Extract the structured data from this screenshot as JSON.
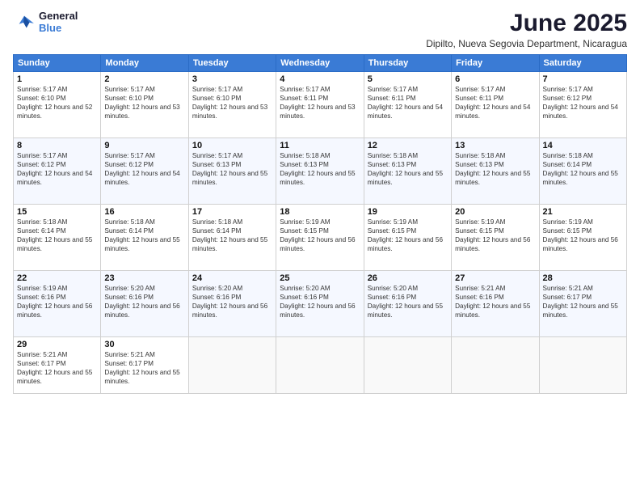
{
  "header": {
    "logo_line1": "General",
    "logo_line2": "Blue",
    "month": "June 2025",
    "location": "Dipilto, Nueva Segovia Department, Nicaragua"
  },
  "days_of_week": [
    "Sunday",
    "Monday",
    "Tuesday",
    "Wednesday",
    "Thursday",
    "Friday",
    "Saturday"
  ],
  "weeks": [
    [
      {
        "day": 1,
        "rise": "5:17 AM",
        "set": "6:10 PM",
        "hours": "12 hours and 52 minutes"
      },
      {
        "day": 2,
        "rise": "5:17 AM",
        "set": "6:10 PM",
        "hours": "12 hours and 53 minutes"
      },
      {
        "day": 3,
        "rise": "5:17 AM",
        "set": "6:10 PM",
        "hours": "12 hours and 53 minutes"
      },
      {
        "day": 4,
        "rise": "5:17 AM",
        "set": "6:11 PM",
        "hours": "12 hours and 53 minutes"
      },
      {
        "day": 5,
        "rise": "5:17 AM",
        "set": "6:11 PM",
        "hours": "12 hours and 54 minutes"
      },
      {
        "day": 6,
        "rise": "5:17 AM",
        "set": "6:11 PM",
        "hours": "12 hours and 54 minutes"
      },
      {
        "day": 7,
        "rise": "5:17 AM",
        "set": "6:12 PM",
        "hours": "12 hours and 54 minutes"
      }
    ],
    [
      {
        "day": 8,
        "rise": "5:17 AM",
        "set": "6:12 PM",
        "hours": "12 hours and 54 minutes"
      },
      {
        "day": 9,
        "rise": "5:17 AM",
        "set": "6:12 PM",
        "hours": "12 hours and 54 minutes"
      },
      {
        "day": 10,
        "rise": "5:17 AM",
        "set": "6:13 PM",
        "hours": "12 hours and 55 minutes"
      },
      {
        "day": 11,
        "rise": "5:18 AM",
        "set": "6:13 PM",
        "hours": "12 hours and 55 minutes"
      },
      {
        "day": 12,
        "rise": "5:18 AM",
        "set": "6:13 PM",
        "hours": "12 hours and 55 minutes"
      },
      {
        "day": 13,
        "rise": "5:18 AM",
        "set": "6:13 PM",
        "hours": "12 hours and 55 minutes"
      },
      {
        "day": 14,
        "rise": "5:18 AM",
        "set": "6:14 PM",
        "hours": "12 hours and 55 minutes"
      }
    ],
    [
      {
        "day": 15,
        "rise": "5:18 AM",
        "set": "6:14 PM",
        "hours": "12 hours and 55 minutes"
      },
      {
        "day": 16,
        "rise": "5:18 AM",
        "set": "6:14 PM",
        "hours": "12 hours and 55 minutes"
      },
      {
        "day": 17,
        "rise": "5:18 AM",
        "set": "6:14 PM",
        "hours": "12 hours and 55 minutes"
      },
      {
        "day": 18,
        "rise": "5:19 AM",
        "set": "6:15 PM",
        "hours": "12 hours and 56 minutes"
      },
      {
        "day": 19,
        "rise": "5:19 AM",
        "set": "6:15 PM",
        "hours": "12 hours and 56 minutes"
      },
      {
        "day": 20,
        "rise": "5:19 AM",
        "set": "6:15 PM",
        "hours": "12 hours and 56 minutes"
      },
      {
        "day": 21,
        "rise": "5:19 AM",
        "set": "6:15 PM",
        "hours": "12 hours and 56 minutes"
      }
    ],
    [
      {
        "day": 22,
        "rise": "5:19 AM",
        "set": "6:16 PM",
        "hours": "12 hours and 56 minutes"
      },
      {
        "day": 23,
        "rise": "5:20 AM",
        "set": "6:16 PM",
        "hours": "12 hours and 56 minutes"
      },
      {
        "day": 24,
        "rise": "5:20 AM",
        "set": "6:16 PM",
        "hours": "12 hours and 56 minutes"
      },
      {
        "day": 25,
        "rise": "5:20 AM",
        "set": "6:16 PM",
        "hours": "12 hours and 56 minutes"
      },
      {
        "day": 26,
        "rise": "5:20 AM",
        "set": "6:16 PM",
        "hours": "12 hours and 55 minutes"
      },
      {
        "day": 27,
        "rise": "5:21 AM",
        "set": "6:16 PM",
        "hours": "12 hours and 55 minutes"
      },
      {
        "day": 28,
        "rise": "5:21 AM",
        "set": "6:17 PM",
        "hours": "12 hours and 55 minutes"
      }
    ],
    [
      {
        "day": 29,
        "rise": "5:21 AM",
        "set": "6:17 PM",
        "hours": "12 hours and 55 minutes"
      },
      {
        "day": 30,
        "rise": "5:21 AM",
        "set": "6:17 PM",
        "hours": "12 hours and 55 minutes"
      },
      null,
      null,
      null,
      null,
      null
    ]
  ]
}
